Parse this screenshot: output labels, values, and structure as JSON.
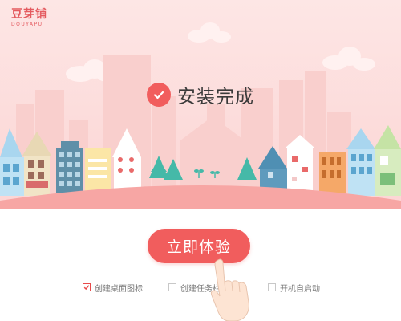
{
  "app": {
    "logo_text": "豆芽铺",
    "logo_subtext": "DOUYAPU"
  },
  "status": {
    "text": "安装完成",
    "icon": "check-circle-icon"
  },
  "primary_action": {
    "label": "立即体验"
  },
  "options": [
    {
      "label": "创建桌面图标",
      "checked": true
    },
    {
      "label": "创建任务栏",
      "checked": false
    },
    {
      "label": "开机自启动",
      "checked": false
    }
  ],
  "colors": {
    "accent": "#f15d5d",
    "sky_top": "#fcdcdb",
    "ground": "#f7a6a4"
  }
}
